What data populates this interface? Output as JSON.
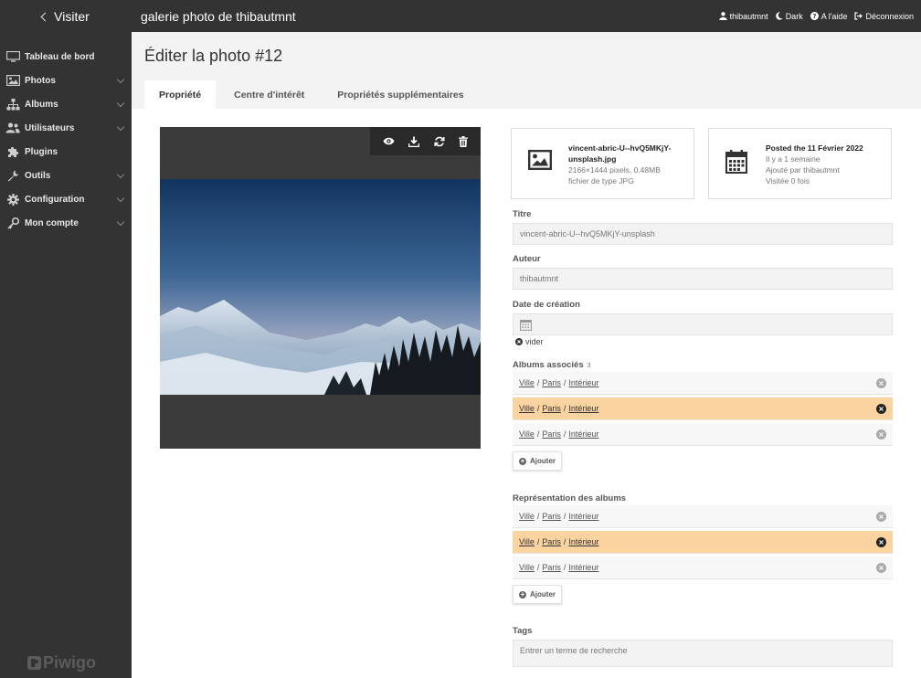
{
  "sidebar": {
    "visit_label": "Visiter",
    "items": [
      {
        "label": "Tableau de bord",
        "icon": "monitor-icon",
        "has_arrow": false
      },
      {
        "label": "Photos",
        "icon": "image-icon",
        "has_arrow": true
      },
      {
        "label": "Albums",
        "icon": "sitemap-icon",
        "has_arrow": true
      },
      {
        "label": "Utilisateurs",
        "icon": "users-icon",
        "has_arrow": true
      },
      {
        "label": "Plugins",
        "icon": "puzzle-icon",
        "has_arrow": false
      },
      {
        "label": "Outils",
        "icon": "wrench-icon",
        "has_arrow": true
      },
      {
        "label": "Configuration",
        "icon": "gear-icon",
        "has_arrow": true
      },
      {
        "label": "Mon compte",
        "icon": "key-icon",
        "has_arrow": true
      }
    ],
    "logo_text": "Piwigo"
  },
  "topbar": {
    "site_title": "galerie photo de thibautmnt",
    "user": "thibautmnt",
    "dark": "Dark",
    "help": "A l'aide",
    "logout": "Déconnexion"
  },
  "page": {
    "title": "Éditer la photo #12",
    "tabs": [
      "Propriété",
      "Centre d'intérêt",
      "Propriétés supplémentaires"
    ],
    "active_tab": 0
  },
  "file_card": {
    "filename": "vincent-abric-U--hvQ5MKjY-unsplash.jpg",
    "dimensions": "2166×1444 pixels, 0.48MB",
    "type": "fichier de type JPG"
  },
  "date_card": {
    "posted": "Posted the 11 Février 2022",
    "ago": "Il y a 1 semaine",
    "added_by": "Ajouté par thibautmnt",
    "visits": "Visitée 0 fois"
  },
  "form": {
    "title_label": "Titre",
    "title_value": "vincent-abric-U--hvQ5MKjY-unsplash",
    "author_label": "Auteur",
    "author_value": "thibautmnt",
    "date_label": "Date de création",
    "clear_label": "vider",
    "albums_label": "Albums associés",
    "albums_count": "3",
    "albums": [
      {
        "parts": [
          "Ville",
          "Paris",
          "Intérieur"
        ],
        "highlighted": false
      },
      {
        "parts": [
          "Ville",
          "Paris",
          "Intérieur"
        ],
        "highlighted": true
      },
      {
        "parts": [
          "Ville",
          "Paris",
          "Intérieur"
        ],
        "highlighted": false
      }
    ],
    "add_label": "Ajouter",
    "represent_label": "Représentation des albums",
    "represent": [
      {
        "parts": [
          "Ville",
          "Paris",
          "Intérieur"
        ],
        "highlighted": false
      },
      {
        "parts": [
          "Ville",
          "Paris",
          "Intérieur"
        ],
        "highlighted": true
      },
      {
        "parts": [
          "Ville",
          "Paris",
          "Intérieur"
        ],
        "highlighted": false
      }
    ],
    "tags_label": "Tags",
    "tags_placeholder": "Entrer un terme de recherche"
  },
  "colors": {
    "sidebar_bg": "#333333",
    "highlight_row": "#fad3a1",
    "panel_bg": "#ffffff"
  }
}
